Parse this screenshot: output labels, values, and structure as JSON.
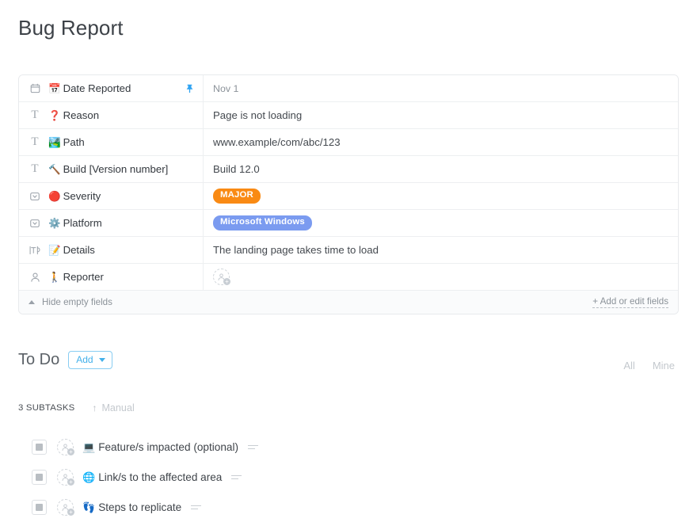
{
  "page": {
    "title": "Bug Report"
  },
  "fields": {
    "rows": [
      {
        "type_icon": "calendar-icon",
        "emoji": "📅",
        "label": "Date Reported",
        "pinned": true,
        "value": "Nov 1",
        "value_kind": "muted-text"
      },
      {
        "type_icon": "text-icon",
        "emoji": "❓",
        "label": "Reason",
        "pinned": false,
        "value": "Page is not loading",
        "value_kind": "text"
      },
      {
        "type_icon": "text-icon",
        "emoji": "🏞️",
        "label": "Path",
        "pinned": false,
        "value": "www.example/com/abc/123",
        "value_kind": "text"
      },
      {
        "type_icon": "text-icon",
        "emoji": "🔨",
        "label": "Build [Version number]",
        "pinned": false,
        "value": "Build 12.0",
        "value_kind": "text"
      },
      {
        "type_icon": "dropdown-icon",
        "emoji": "🔴",
        "label": "Severity",
        "pinned": false,
        "value": "MAJOR",
        "value_kind": "badge",
        "badge_color": "#f98a14"
      },
      {
        "type_icon": "dropdown-icon",
        "emoji": "⚙️",
        "label": "Platform",
        "pinned": false,
        "value": "Microsoft Windows",
        "value_kind": "badge",
        "badge_color": "#7b9bf0"
      },
      {
        "type_icon": "textarea-icon",
        "emoji": "📝",
        "label": "Details",
        "pinned": false,
        "value": "The landing page takes time to load",
        "value_kind": "text"
      },
      {
        "type_icon": "person-icon",
        "emoji": "🚶",
        "label": "Reporter",
        "pinned": false,
        "value": "",
        "value_kind": "avatar-placeholder"
      }
    ],
    "footer": {
      "hide_empty_label": "Hide empty fields",
      "add_edit_label": "+ Add or edit fields"
    }
  },
  "todo": {
    "title": "To Do",
    "add_label": "Add",
    "filters": [
      "All",
      "Mine"
    ],
    "subtasks_count_label": "3 SUBTASKS",
    "sort_mode_label": "Manual",
    "sort_arrow": "↑",
    "subtasks": [
      {
        "emoji": "💻",
        "name": "Feature/s impacted (optional)",
        "has_notes": true
      },
      {
        "emoji": "🌐",
        "name": "Link/s to the affected area",
        "has_notes": true
      },
      {
        "emoji": "👣",
        "name": "Steps to replicate",
        "has_notes": true
      }
    ]
  },
  "colors": {
    "accent_blue": "#43b0ea",
    "severity_orange": "#f98a14",
    "platform_blue": "#7b9bf0",
    "pin_blue": "#2ea3f2"
  }
}
